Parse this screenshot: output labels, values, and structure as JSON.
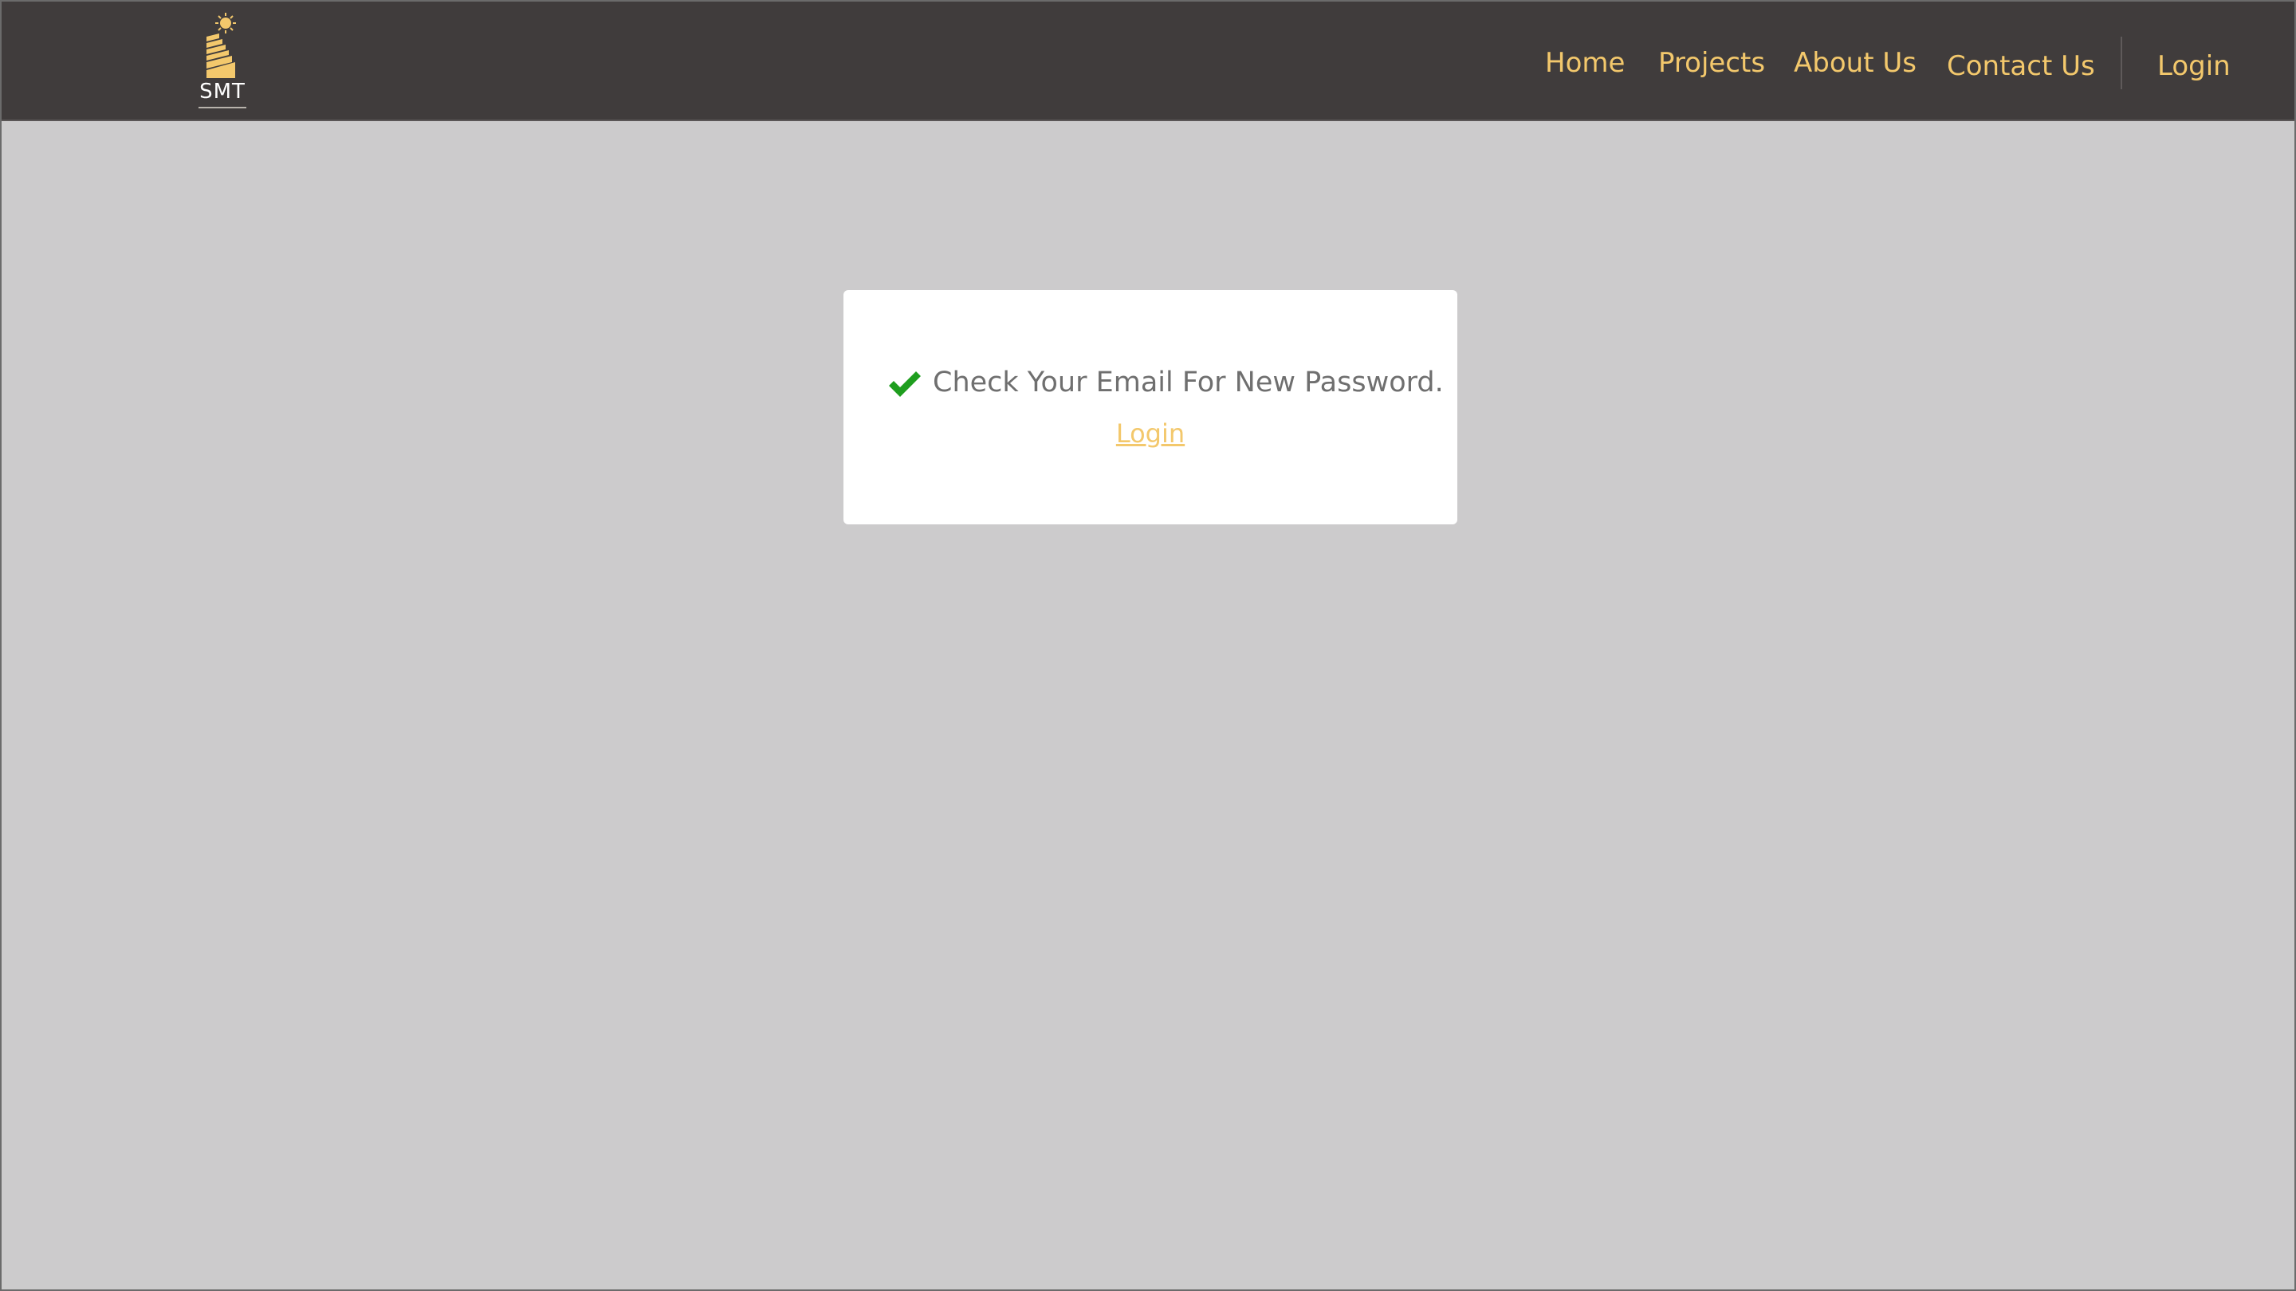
{
  "brand": {
    "logo_text": "SMT",
    "logo_icon": "building-sun-icon",
    "accent_color": "#f3c86c"
  },
  "nav": {
    "items": [
      {
        "label": "Home"
      },
      {
        "label": "Projects"
      },
      {
        "label": "About Us"
      },
      {
        "label": "Contact Us"
      }
    ],
    "login_label": "Login"
  },
  "card": {
    "status_icon": "checkmark-icon",
    "status_color": "#1e9e1e",
    "message": "Check Your Email For New Password.",
    "login_link": "Login"
  }
}
